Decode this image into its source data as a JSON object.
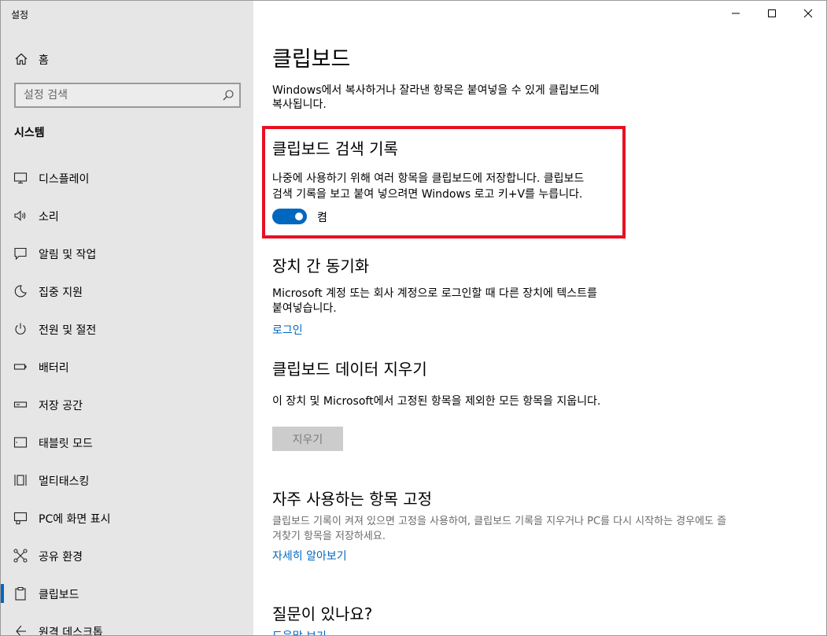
{
  "window": {
    "app_title": "설정",
    "minimize_icon": "minimize-icon",
    "maximize_icon": "maximize-icon",
    "close_icon": "close-icon"
  },
  "sidebar": {
    "home_label": "홈",
    "search_placeholder": "설정 검색",
    "section_title": "시스템",
    "items": [
      {
        "label": "디스플레이",
        "icon": "display-icon"
      },
      {
        "label": "소리",
        "icon": "speaker-icon"
      },
      {
        "label": "알림 및 작업",
        "icon": "notification-icon"
      },
      {
        "label": "집중 지원",
        "icon": "moon-icon"
      },
      {
        "label": "전원 및 절전",
        "icon": "power-icon"
      },
      {
        "label": "배터리",
        "icon": "battery-icon"
      },
      {
        "label": "저장 공간",
        "icon": "storage-icon"
      },
      {
        "label": "태블릿 모드",
        "icon": "tablet-icon"
      },
      {
        "label": "멀티태스킹",
        "icon": "multitasking-icon"
      },
      {
        "label": "PC에 화면 표시",
        "icon": "project-icon"
      },
      {
        "label": "공유 환경",
        "icon": "share-icon"
      },
      {
        "label": "클립보드",
        "icon": "clipboard-icon"
      },
      {
        "label": "원격 데스크톱",
        "icon": "remote-desktop-icon"
      }
    ],
    "selected_index": 11
  },
  "main": {
    "page_title": "클립보드",
    "intro_line1": "Windows에서 복사하거나 잘라낸 항목은 붙여넣을 수 있게 클립보드에",
    "intro_line2": "복사됩니다.",
    "history": {
      "heading": "클립보드 검색 기록",
      "desc_line1": "나중에 사용하기 위해 여러 항목을 클립보드에 저장합니다. 클립보드",
      "desc_line2": "검색 기록을 보고 붙여 넣으려면 Windows 로고 키+V를 누릅니다.",
      "toggle_state": "켬",
      "toggle_on": true
    },
    "sync": {
      "heading": "장치 간 동기화",
      "desc_line1": "Microsoft 계정 또는 회사 계정으로 로그인할 때 다른 장치에 텍스트를",
      "desc_line2": "붙여넣습니다.",
      "link": "로그인"
    },
    "clear": {
      "heading": "클립보드 데이터 지우기",
      "desc": "이 장치 및 Microsoft에서 고정된 항목을 제외한 모든 항목을 지웁니다.",
      "button": "지우기"
    },
    "pin": {
      "heading": "자주 사용하는 항목 고정",
      "desc_line1": "클립보드 기록이 켜져 있으면 고정을 사용하여, 클립보드 기록을 지우거나 PC를 다시 시작하는 경우에도 즐",
      "desc_line2": "겨찾기 항목을 저장하세요.",
      "link": "자세히 알아보기"
    },
    "questions": {
      "heading": "질문이 있나요?",
      "link": "도움말 보기"
    }
  },
  "colors": {
    "accent": "#0067c0",
    "highlight_border": "#e81123",
    "sidebar_bg": "#e6e6e6"
  }
}
